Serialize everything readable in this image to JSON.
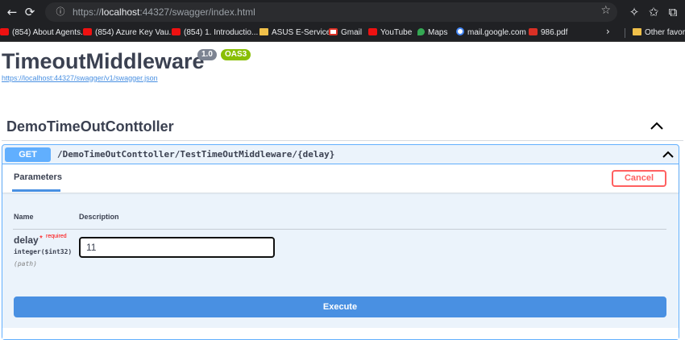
{
  "browser": {
    "url_scheme": "https://",
    "url_host": "localhost",
    "url_rest": ":44327/swagger/index.html",
    "icons": {
      "back": "back-arrow-icon",
      "reload": "reload-icon",
      "site_info": "site-info-icon",
      "favorite": "star-icon",
      "extensions": "puzzle-icon",
      "favorites": "favorites-icon",
      "collections": "collections-icon"
    },
    "bookmarks": [
      {
        "label": "(854) About Agents...",
        "icon": "youtube-icon"
      },
      {
        "label": "(854) Azure Key Vau...",
        "icon": "youtube-icon"
      },
      {
        "label": "(854) 1. Introductio...",
        "icon": "youtube-icon"
      },
      {
        "label": "ASUS E-Service",
        "icon": "folder-icon"
      },
      {
        "label": "Gmail",
        "icon": "gmail-icon"
      },
      {
        "label": "YouTube",
        "icon": "youtube-icon"
      },
      {
        "label": "Maps",
        "icon": "maps-icon"
      },
      {
        "label": "mail.google.com",
        "icon": "google-icon"
      },
      {
        "label": "986.pdf",
        "icon": "pdf-icon"
      }
    ],
    "other_favorites": "Other favorite"
  },
  "swagger": {
    "title": "TimeoutMiddleware",
    "version": "1.0",
    "oas": "OAS3",
    "spec_url": "https://localhost:44327/swagger/v1/swagger.json",
    "tag": "DemoTimeOutConttoller",
    "operation": {
      "method": "GET",
      "path": "/DemoTimeOutConttoller/TestTimeOutMiddleware/{delay}",
      "tab": "Parameters",
      "cancel_label": "Cancel",
      "columns": {
        "name": "Name",
        "description": "Description"
      },
      "param": {
        "name": "delay",
        "star": "*",
        "required": "required",
        "type": "integer($int32)",
        "in": "(path)",
        "value": "11"
      },
      "execute_label": "Execute"
    }
  },
  "colors": {
    "get": "#61affe",
    "execute": "#4990e2",
    "cancel": "#ff6060",
    "oas_badge": "#89bf04"
  }
}
